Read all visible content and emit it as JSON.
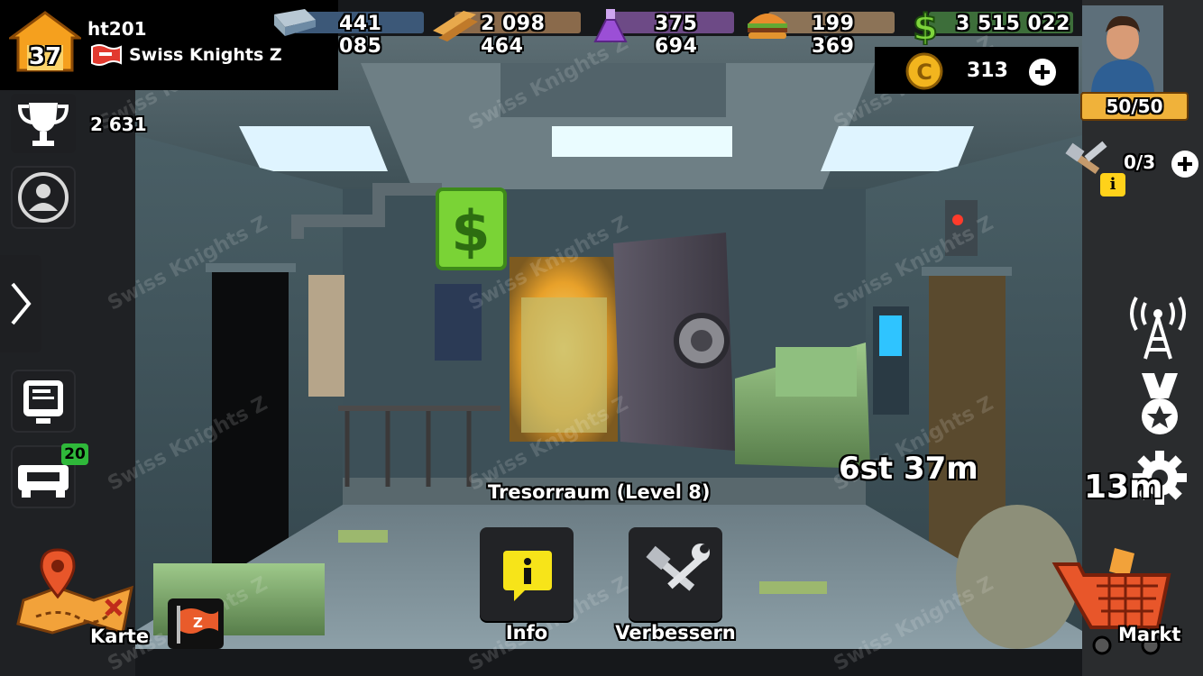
{
  "player": {
    "level": "37",
    "name": "ht201",
    "clan": "Swiss Knights Z",
    "trophies": "2 631",
    "energy": "50/50"
  },
  "resources": {
    "steel": "441 085",
    "wood": "2 098 464",
    "chemicals": "375 694",
    "food": "199 369",
    "cash": "3 515 022",
    "coins": "313"
  },
  "builders": "0/3",
  "badges": {
    "garage": "20"
  },
  "room": {
    "title": "Tresorraum (Level 8)",
    "timer": "6st 37m",
    "partial_timer": "13m"
  },
  "actions": {
    "info": "Info",
    "upgrade": "Verbessern"
  },
  "nav": {
    "map": "Karte",
    "market": "Markt"
  },
  "watermark": "Swiss Knights Z",
  "flag_badge": "Z",
  "colors": {
    "steel_bar": "#3c5878",
    "wood_bar": "#8a6a4b",
    "chem_bar": "#6d4a86",
    "food_bar": "#8c7357",
    "cash_bar": "#3d6e3a",
    "energy_bg": "#f0b23a",
    "builder_badge": "#ffd21a",
    "garage_badge": "#2fb83a"
  },
  "icons": [
    "home-level-icon",
    "flag-icon",
    "trophy-icon",
    "profile-icon",
    "chevron-right-icon",
    "computer-icon",
    "garage-icon",
    "map-icon",
    "steel-icon",
    "wood-icon",
    "chemical-flask-icon",
    "burger-icon",
    "dollar-icon",
    "coin-icon",
    "plus-icon",
    "avatar",
    "builder-hammer-icon",
    "radio-tower-icon",
    "medal-icon",
    "gear-icon",
    "shopping-cart-icon",
    "info-icon",
    "hammer-wrench-icon"
  ]
}
